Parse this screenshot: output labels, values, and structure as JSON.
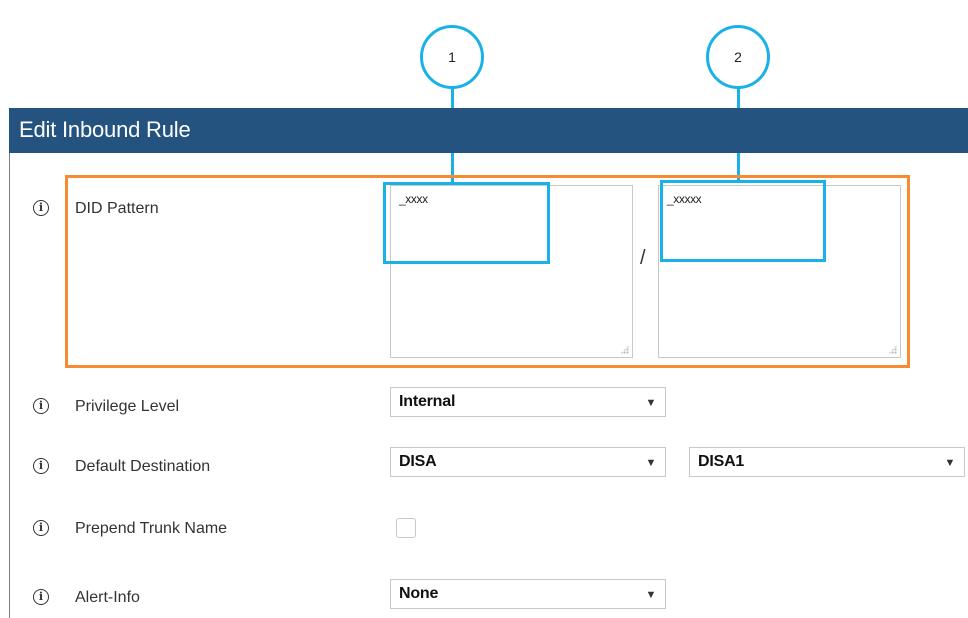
{
  "header": {
    "title": "Edit Inbound Rule"
  },
  "did_pattern": {
    "label": "DID Pattern",
    "pattern_1": "_xxxx",
    "pattern_2": "_xxxxx",
    "separator": "/"
  },
  "annotations": {
    "callout_1": "1",
    "callout_2": "2"
  },
  "privilege_level": {
    "label": "Privilege Level",
    "value": "Internal"
  },
  "default_destination": {
    "label": "Default Destination",
    "type_value": "DISA",
    "target_value": "DISA1"
  },
  "prepend_trunk_name": {
    "label": "Prepend Trunk Name",
    "checked": false
  },
  "alert_info": {
    "label": "Alert-Info",
    "value": "None"
  },
  "icons": {
    "info": "info-icon",
    "dropdown": "triangle-down-icon"
  },
  "colors": {
    "header_bg": "#245380",
    "highlight_orange": "#f68b33",
    "annotation_cyan": "#1ab2e6"
  }
}
